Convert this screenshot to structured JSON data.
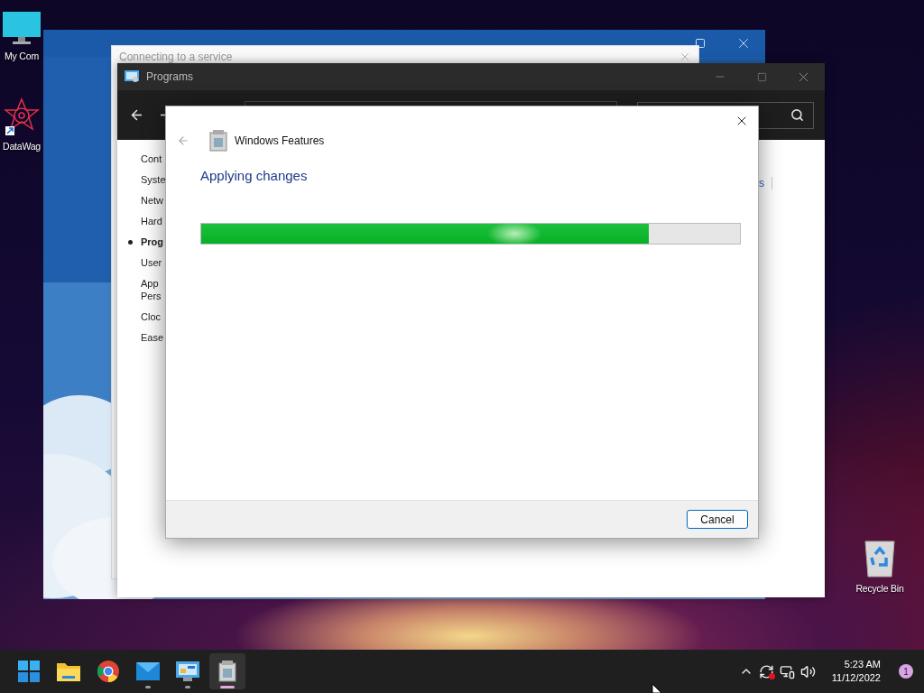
{
  "desktop_icons": [
    {
      "kind": "computer",
      "label": "My Com"
    },
    {
      "kind": "app",
      "label": "DataWag"
    },
    {
      "kind": "recycle",
      "label": "Recycle Bin"
    }
  ],
  "service_window": {
    "title": "Connecting to a service"
  },
  "programs_window": {
    "title": "Programs",
    "sidebar": [
      {
        "lines": [
          "Cont"
        ],
        "selected": false
      },
      {
        "lines": [
          "Syste"
        ],
        "selected": false
      },
      {
        "lines": [
          "Netw"
        ],
        "selected": false
      },
      {
        "lines": [
          "Hard"
        ],
        "selected": false
      },
      {
        "lines": [
          "Prog"
        ],
        "selected": true
      },
      {
        "lines": [
          "User"
        ],
        "selected": false
      },
      {
        "lines": [
          "App",
          "Pers"
        ],
        "selected": false
      },
      {
        "lines": [
          "Cloc"
        ],
        "selected": false
      },
      {
        "lines": [
          "Ease"
        ],
        "selected": false
      }
    ],
    "link_fragment": "s"
  },
  "dialog": {
    "title": "Windows Features",
    "back_enabled": false,
    "heading": "Applying changes",
    "progress": {
      "level": 0.83
    },
    "buttons": [
      {
        "label": "Cancel",
        "default": true
      }
    ]
  },
  "taskbar": {
    "apps": [
      {
        "kind": "start",
        "running": false,
        "selected": false
      },
      {
        "kind": "explorer",
        "running": false,
        "selected": false
      },
      {
        "kind": "browser",
        "running": false,
        "selected": false
      },
      {
        "kind": "mail",
        "running": true,
        "selected": false
      },
      {
        "kind": "control-panel",
        "running": true,
        "selected": false
      },
      {
        "kind": "features",
        "running": true,
        "selected": true
      }
    ],
    "time": "5:23 AM",
    "date": "11/12/2022",
    "notification_count": "1"
  }
}
